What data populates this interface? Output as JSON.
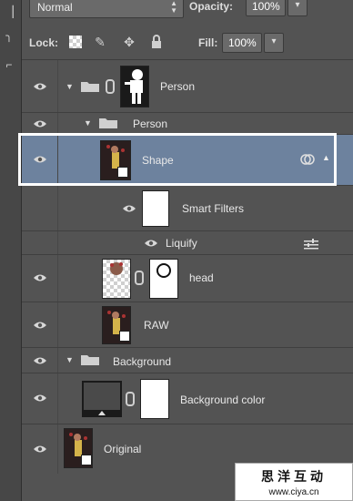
{
  "panel": {
    "blend_mode": "Normal",
    "opacity_label": "Opacity:",
    "opacity_value": "100%",
    "lock_label": "Lock:",
    "fill_label": "Fill:",
    "fill_value": "100%"
  },
  "layers": [
    {
      "name": "Person",
      "kind": "group-with-mask",
      "expanded": true
    },
    {
      "name": "Person",
      "kind": "group",
      "expanded": true
    },
    {
      "name": "Shape",
      "kind": "smart-object",
      "selected": true
    },
    {
      "name": "Smart Filters",
      "kind": "smart-filters"
    },
    {
      "name": "Liquify",
      "kind": "filter"
    },
    {
      "name": "head",
      "kind": "layer-with-mask"
    },
    {
      "name": "RAW",
      "kind": "smart-object"
    },
    {
      "name": "Background",
      "kind": "group",
      "expanded": true
    },
    {
      "name": "Background color",
      "kind": "layer-with-mask"
    },
    {
      "name": "Original",
      "kind": "smart-object"
    }
  ],
  "watermark": {
    "line1": "思洋互动",
    "line2": "www.ciya.cn"
  },
  "colors": {
    "panel_bg": "#535353",
    "selected_bg": "#6d829e",
    "highlight_border": "#ffffff"
  }
}
